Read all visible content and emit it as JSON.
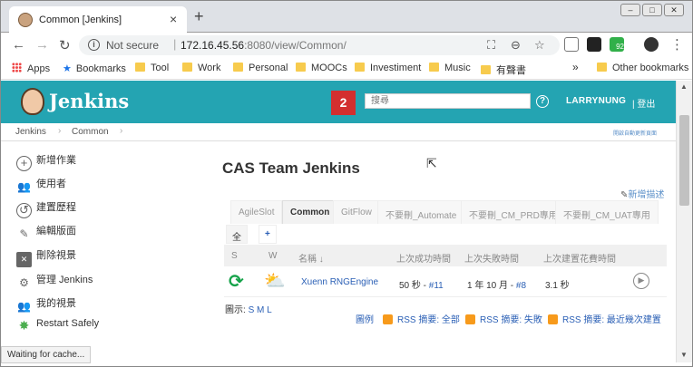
{
  "browser": {
    "tab_title": "Common [Jenkins]",
    "tab_close": "×",
    "new_tab": "+",
    "security_label": "Not secure",
    "url_host": "172.16.45.56",
    "url_path": ":8080/view/Common/",
    "bookmarks": [
      "Apps",
      "Bookmarks",
      "Tool",
      "Work",
      "Personal",
      "MOOCs",
      "Investiment",
      "Music",
      "有聲書"
    ],
    "bookmarks_more": "»",
    "other_bookmarks": "Other bookmarks",
    "ext_badge": "92"
  },
  "header": {
    "logo_text": "Jenkins",
    "notification_count": "2",
    "search_placeholder": "搜尋",
    "help": "?",
    "username": "LARRYNUNG",
    "logout": "| 登出"
  },
  "breadcrumb": {
    "items": [
      "Jenkins",
      "Common"
    ],
    "separator": "›",
    "auto_refresh": "開啟自動更新頁面"
  },
  "sidebar": {
    "items": [
      {
        "label": "新增作業",
        "icon": "add-icon"
      },
      {
        "label": "使用者",
        "icon": "people-icon"
      },
      {
        "label": "建置歷程",
        "icon": "history-icon"
      },
      {
        "label": "編輯版面",
        "icon": "edit-icon"
      },
      {
        "label": "刪除視景",
        "icon": "delete-icon"
      },
      {
        "label": "管理 Jenkins",
        "icon": "gear-icon"
      },
      {
        "label": "我的視景",
        "icon": "people-icon"
      },
      {
        "label": "Restart Safely",
        "icon": "restart-icon"
      }
    ]
  },
  "main": {
    "title": "CAS Team Jenkins",
    "add_description": "新增描述",
    "view_tabs": [
      "AgileSlot",
      "Common",
      "GitFlow",
      "不要刪_Automate",
      "不要刪_CM_PRD專用",
      "不要刪_CM_UAT專用"
    ],
    "active_tab": "Common",
    "sub_tabs": [
      "全部",
      "+"
    ],
    "table": {
      "headers": [
        "S",
        "W",
        "名稱 ↓",
        "上次成功時間",
        "上次失敗時間",
        "上次建置花費時間"
      ],
      "rows": [
        {
          "name": "Xuenn RNGEngine",
          "last_success": "50 秒 - ",
          "last_success_build": "#11",
          "last_failure": "1 年 10 月 - ",
          "last_failure_build": "#8",
          "duration": "3.1 秒"
        }
      ]
    },
    "icon_label": "圖示: ",
    "icon_sizes": "S M L",
    "legend": "圖例",
    "rss_all": "RSS 摘要: 全部",
    "rss_failed": "RSS 摘要: 失敗",
    "rss_latest": "RSS 摘要: 最近幾次建置"
  },
  "status": {
    "text": "Waiting for cache..."
  },
  "colors": {
    "header_bg": "#24a4b2",
    "notification": "#d32f2f",
    "link": "#2a5fb5",
    "rss": "#f79a1b"
  }
}
